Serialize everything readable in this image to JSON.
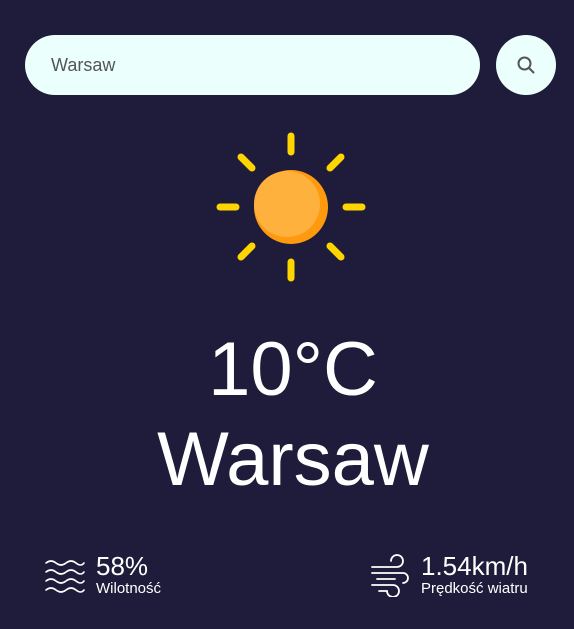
{
  "search": {
    "value": "Warsaw",
    "button_icon": "search-icon"
  },
  "weather": {
    "icon": "sun-icon",
    "temperature": "10°C",
    "city": "Warsaw"
  },
  "details": {
    "humidity": {
      "icon": "humidity-waves-icon",
      "value": "58%",
      "label": "Wilotność"
    },
    "wind": {
      "icon": "wind-icon",
      "value": "1.54km/h",
      "label": "Prędkość wiatru"
    }
  },
  "colors": {
    "background": "#1e1c3a",
    "input_background": "#ebfffc",
    "sun_core": "#ffa41b",
    "sun_rays": "#ffd500",
    "text": "#ffffff"
  }
}
